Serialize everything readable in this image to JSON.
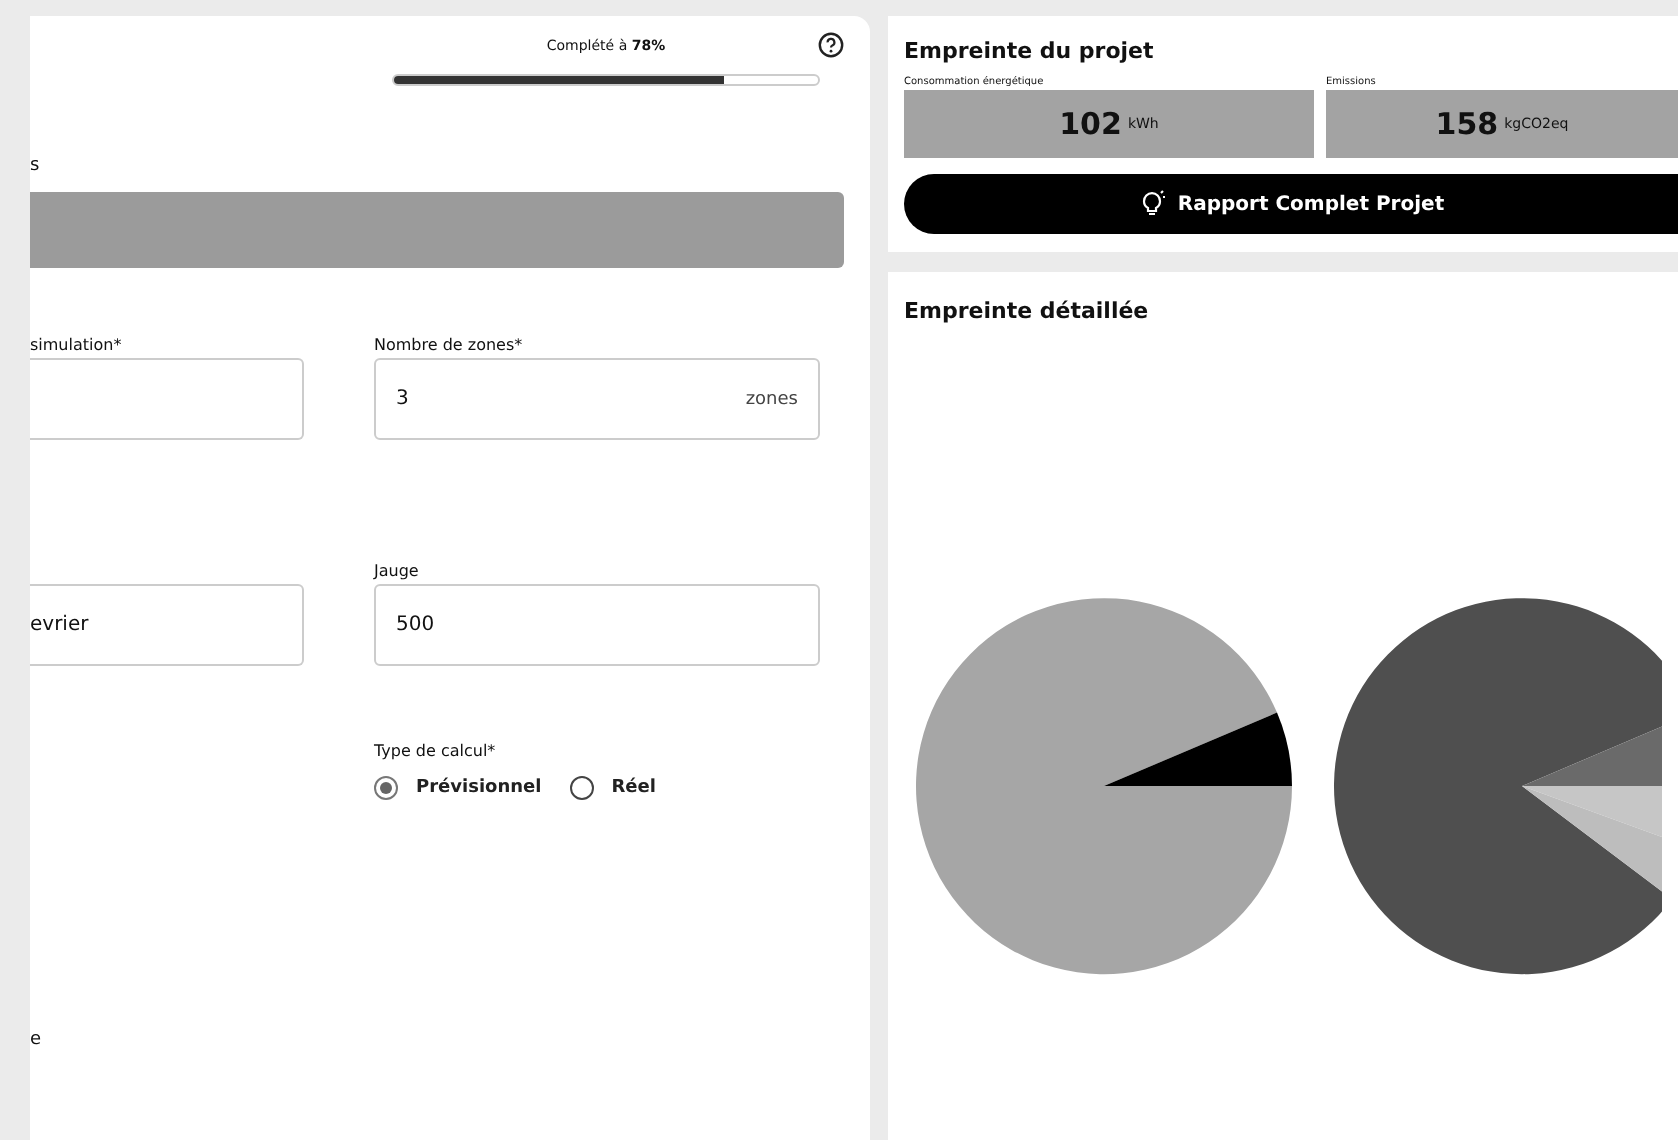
{
  "progress": {
    "label": "Complété à **78%**",
    "level": 0.78
  },
  "form": {
    "heading_fragment": "s",
    "fields": [
      {
        "label": "simulation*"
      },
      {
        "value": "evrier"
      },
      {
        "label": "Nombre de zones*",
        "value": "3",
        "suffix": "zones"
      },
      {
        "label": "Jauge",
        "value": "500"
      }
    ],
    "calc_type": {
      "label": "Type de calcul*",
      "options": [
        {
          "label": "Prévisionnel",
          "selected": true
        },
        {
          "label": "Réel",
          "selected": false
        }
      ]
    },
    "footer_fragment": "e"
  },
  "footprint": {
    "title": "Empreinte du projet",
    "metrics": [
      {
        "label": "Consommation énergétique",
        "value": "102",
        "unit": "kWh"
      },
      {
        "label": "Emissions",
        "value": "158",
        "unit": "kgCO2eq"
      }
    ],
    "report_button": "Rapport Complet Projet"
  },
  "detail": {
    "title": "Empreinte détaillée"
  }
}
